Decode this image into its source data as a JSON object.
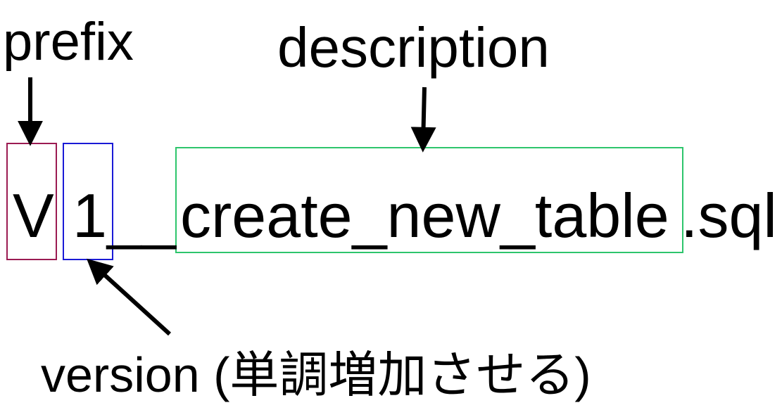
{
  "labels": {
    "prefix": "prefix",
    "description": "description",
    "version": "version (単調増加させる)"
  },
  "filename": {
    "prefix": "V",
    "version": "1",
    "separator": "__",
    "description": "create_new_table",
    "extension": ".sql"
  },
  "colors": {
    "prefix_box": "#9b1b52",
    "version_box": "#1a1ad6",
    "description_box": "#2ec56c",
    "arrow": "#000000",
    "text": "#000000",
    "background": "#ffffff"
  }
}
